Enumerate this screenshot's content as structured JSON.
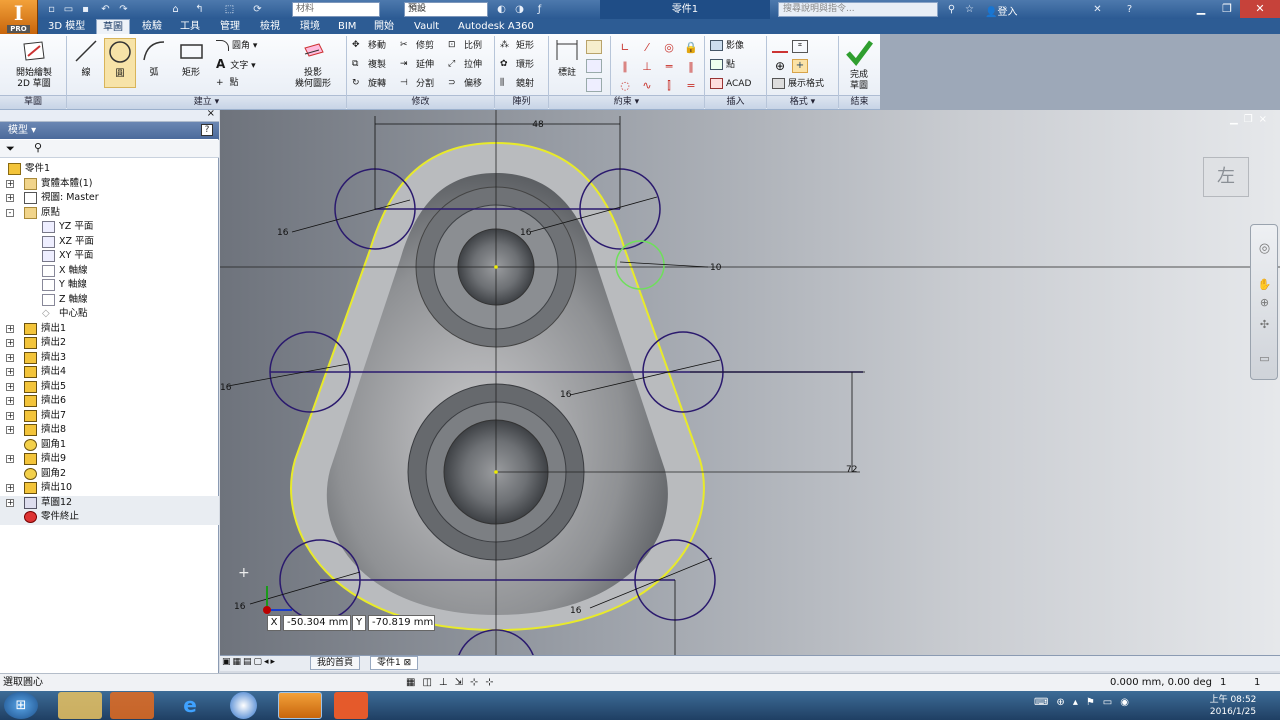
{
  "app": {
    "logo_letter": "I",
    "logo_sub": "PRO"
  },
  "titlebar": {
    "material_placeholder": "材料",
    "appearance_value": "預設",
    "doc_title": "零件1",
    "search_placeholder": "搜尋說明與指令...",
    "signin": "登入"
  },
  "tabs": [
    "3D 模型",
    "草圖",
    "檢驗",
    "工具",
    "管理",
    "檢視",
    "環境",
    "BIM",
    "開始",
    "Vault",
    "Autodesk A360"
  ],
  "active_tab": "草圖",
  "ribbon": {
    "start_sketch": [
      "開始繪製",
      "2D 草圖"
    ],
    "line": "線",
    "circle": "圓",
    "arc": "弧",
    "rect": "矩形",
    "fillet": "圓角",
    "text": "文字",
    "point": "點",
    "project": [
      "投影",
      "幾何圖形"
    ],
    "move": "移動",
    "trim": "修剪",
    "scale": "比例",
    "copy": "複製",
    "extend": "延伸",
    "stretch": "拉伸",
    "rotate": "旋轉",
    "split": "分割",
    "offset": "偏移",
    "rect_pattern": "矩形",
    "circ_pattern": "環形",
    "mirror": "鏡射",
    "dimension": "標註",
    "image": "影像",
    "points": "點",
    "acad": "ACAD",
    "show_format": "展示格式",
    "finish": [
      "完成",
      "草圖"
    ],
    "panels": {
      "sketch": "草圖",
      "create": "建立",
      "modify": "修改",
      "pattern": "陣列",
      "constrain": "約束",
      "insert": "插入",
      "format": "格式",
      "exit": "結束"
    }
  },
  "browser": {
    "title": "模型",
    "help": "?",
    "items": [
      {
        "label": "零件1",
        "level": 0,
        "icon": "part-icon",
        "exp": ""
      },
      {
        "label": "實體本體(1)",
        "level": 1,
        "icon": "folder-icon",
        "exp": "+"
      },
      {
        "label": "視圖: Master",
        "level": 1,
        "icon": "view-icon",
        "exp": "+"
      },
      {
        "label": "原點",
        "level": 1,
        "icon": "folder-icon",
        "exp": "-"
      },
      {
        "label": "YZ 平面",
        "level": 2,
        "icon": "plane-icon",
        "exp": ""
      },
      {
        "label": "XZ 平面",
        "level": 2,
        "icon": "plane-icon",
        "exp": ""
      },
      {
        "label": "XY 平面",
        "level": 2,
        "icon": "plane-icon",
        "exp": ""
      },
      {
        "label": "X 軸線",
        "level": 2,
        "icon": "axis-icon",
        "exp": ""
      },
      {
        "label": "Y 軸線",
        "level": 2,
        "icon": "axis-icon",
        "exp": ""
      },
      {
        "label": "Z 軸線",
        "level": 2,
        "icon": "axis-icon",
        "exp": ""
      },
      {
        "label": "中心點",
        "level": 2,
        "icon": "point-icon",
        "exp": ""
      },
      {
        "label": "擠出1",
        "level": 1,
        "icon": "extrude-icon",
        "exp": "+"
      },
      {
        "label": "擠出2",
        "level": 1,
        "icon": "extrude-icon",
        "exp": "+"
      },
      {
        "label": "擠出3",
        "level": 1,
        "icon": "extrude-icon",
        "exp": "+"
      },
      {
        "label": "擠出4",
        "level": 1,
        "icon": "extrude-icon",
        "exp": "+"
      },
      {
        "label": "擠出5",
        "level": 1,
        "icon": "extrude-icon",
        "exp": "+"
      },
      {
        "label": "擠出6",
        "level": 1,
        "icon": "extrude-icon",
        "exp": "+"
      },
      {
        "label": "擠出7",
        "level": 1,
        "icon": "extrude-icon",
        "exp": "+"
      },
      {
        "label": "擠出8",
        "level": 1,
        "icon": "extrude-icon",
        "exp": "+"
      },
      {
        "label": "圓角1",
        "level": 1,
        "icon": "fillet-icon",
        "exp": ""
      },
      {
        "label": "擠出9",
        "level": 1,
        "icon": "extrude-icon",
        "exp": "+"
      },
      {
        "label": "圓角2",
        "level": 1,
        "icon": "fillet-icon",
        "exp": ""
      },
      {
        "label": "擠出10",
        "level": 1,
        "icon": "extrude-icon",
        "exp": "+"
      },
      {
        "label": "草圖12",
        "level": 1,
        "icon": "sketch-icon",
        "exp": "+"
      },
      {
        "label": "零件終止",
        "level": 1,
        "icon": "end-of-part-icon",
        "exp": ""
      }
    ]
  },
  "viewport": {
    "viewcube_label": "左",
    "dimensions": {
      "top_width": "48",
      "hole_left_top": "16",
      "hole_right_top": "16",
      "small_circle": "10",
      "mid_left": "16",
      "mid_right": "16",
      "vertical": "72",
      "bottom_left": "16",
      "bottom_right": "16"
    },
    "coord_x_label": "X",
    "coord_x_value": "-50.304 mm",
    "coord_y_label": "Y",
    "coord_y_value": "-70.819 mm"
  },
  "doc_tabs": [
    "我的首頁",
    "零件1"
  ],
  "status": {
    "prompt": "選取圓心",
    "readout": "0.000 mm, 0.00 deg",
    "count1": "1",
    "count2": "1"
  },
  "taskbar": {
    "time": "上午 08:52",
    "date": "2016/1/25"
  },
  "colors": {
    "accent": "#2b5a93",
    "sketch_curve": "#e8ea2a",
    "sketch_circle": "#2b1a6e",
    "active_circle": "#6ee05a"
  }
}
